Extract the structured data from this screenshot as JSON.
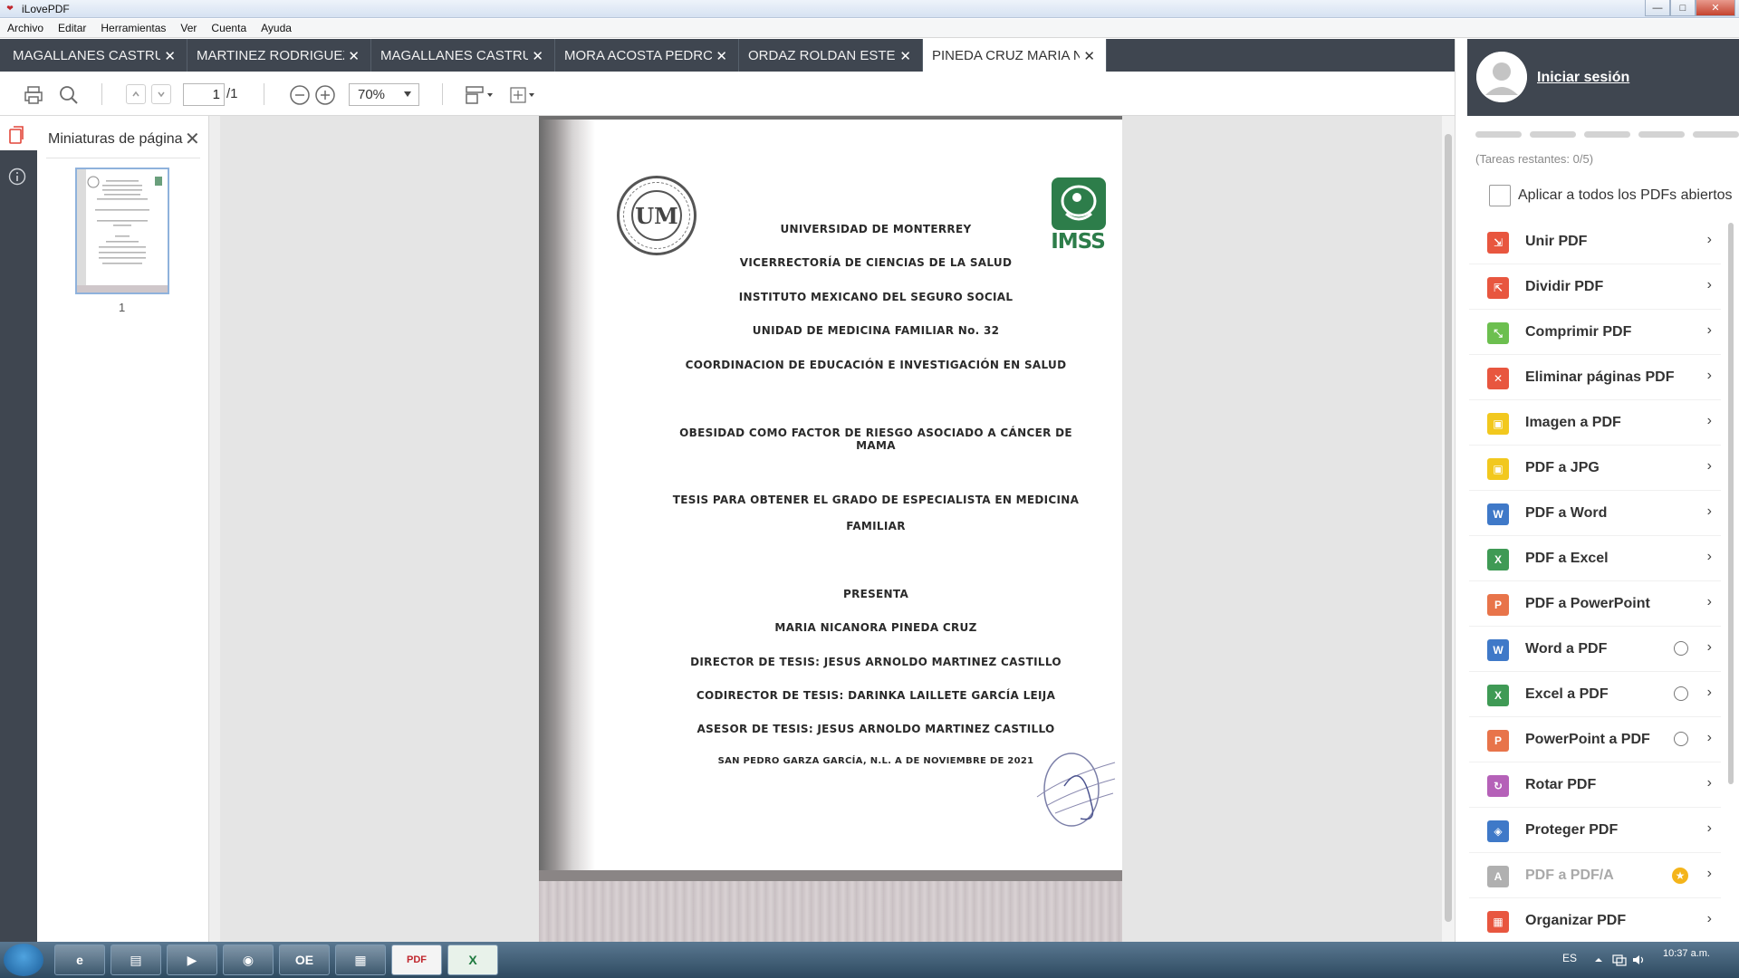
{
  "window": {
    "title": "iLovePDF"
  },
  "menu": [
    "Archivo",
    "Editar",
    "Herramientas",
    "Ver",
    "Cuenta",
    "Ayuda"
  ],
  "tabs": [
    {
      "label": "MAGALLANES CASTRU",
      "active": false
    },
    {
      "label": "MARTINEZ RODRIGUEZ",
      "active": false
    },
    {
      "label": "MAGALLANES CASTRU",
      "active": false
    },
    {
      "label": "MORA ACOSTA PEDRC",
      "active": false
    },
    {
      "label": "ORDAZ ROLDAN ESTEI",
      "active": false
    },
    {
      "label": "PINEDA CRUZ MARIA N",
      "active": true
    }
  ],
  "toolbar": {
    "page_current": "1",
    "page_total": "/1",
    "zoom": "70%"
  },
  "thumbnails": {
    "title": "Miniaturas de página",
    "page_number": "1"
  },
  "document": {
    "lines": [
      "UNIVERSIDAD DE MONTERREY",
      "VICERRECTORÍA DE CIENCIAS DE LA SALUD",
      "INSTITUTO MEXICANO DEL SEGURO SOCIAL",
      "UNIDAD DE MEDICINA FAMILIAR No. 32",
      "COORDINACION DE EDUCACIÓN E INVESTIGACIÓN EN SALUD",
      "OBESIDAD COMO FACTOR DE RIESGO ASOCIADO A CÁNCER DE MAMA",
      "TESIS PARA OBTENER EL GRADO DE ESPECIALISTA EN MEDICINA",
      "FAMILIAR",
      "PRESENTA",
      "MARIA NICANORA PINEDA CRUZ",
      "DIRECTOR DE TESIS: JESUS ARNOLDO MARTINEZ CASTILLO",
      "CODIRECTOR DE TESIS: DARINKA LAILLETE GARCÍA LEIJA",
      "ASESOR DE TESIS: JESUS ARNOLDO MARTINEZ CASTILLO",
      "SAN PEDRO GARZA GARCÍA, N.L. A DE NOVIEMBRE DE 2021"
    ],
    "seal_text": "UM",
    "imss_text": "IMSS"
  },
  "sidebar": {
    "login_label": "Iniciar sesión",
    "tasks_left": "(Tareas restantes: 0/5)",
    "apply_all_label": "Aplicar a todos los PDFs abiertos",
    "tools": [
      {
        "label": "Unir PDF",
        "color": "#e8563f",
        "glyph": "⇲",
        "badge": ""
      },
      {
        "label": "Dividir PDF",
        "color": "#e8563f",
        "glyph": "⇱",
        "badge": ""
      },
      {
        "label": "Comprimir PDF",
        "color": "#6cbf4f",
        "glyph": "⤡",
        "badge": ""
      },
      {
        "label": "Eliminar páginas PDF",
        "color": "#e8563f",
        "glyph": "✕",
        "badge": ""
      },
      {
        "label": "Imagen a PDF",
        "color": "#f2c81e",
        "glyph": "▣",
        "badge": ""
      },
      {
        "label": "PDF a JPG",
        "color": "#f2c81e",
        "glyph": "▣",
        "badge": ""
      },
      {
        "label": "PDF a Word",
        "color": "#3f79c8",
        "glyph": "W",
        "badge": ""
      },
      {
        "label": "PDF a Excel",
        "color": "#3f9a55",
        "glyph": "X",
        "badge": ""
      },
      {
        "label": "PDF a PowerPoint",
        "color": "#e8744a",
        "glyph": "P",
        "badge": ""
      },
      {
        "label": "Word a PDF",
        "color": "#3f79c8",
        "glyph": "W",
        "badge": "globe"
      },
      {
        "label": "Excel a PDF",
        "color": "#3f9a55",
        "glyph": "X",
        "badge": "globe"
      },
      {
        "label": "PowerPoint a PDF",
        "color": "#e8744a",
        "glyph": "P",
        "badge": "globe"
      },
      {
        "label": "Rotar PDF",
        "color": "#b561b8",
        "glyph": "↻",
        "badge": ""
      },
      {
        "label": "Proteger PDF",
        "color": "#3f79c8",
        "glyph": "◈",
        "badge": ""
      },
      {
        "label": "PDF a PDF/A",
        "color": "#b0b0b0",
        "glyph": "A",
        "badge": "crown",
        "disabled": true
      },
      {
        "label": "Organizar PDF",
        "color": "#e8563f",
        "glyph": "▦",
        "badge": ""
      }
    ]
  },
  "taskbar": {
    "apps": [
      "e",
      "▤",
      "▶",
      "◉",
      "OE",
      "▦",
      "PDF",
      "X"
    ],
    "lang": "ES",
    "time": "10:37 a.m."
  }
}
